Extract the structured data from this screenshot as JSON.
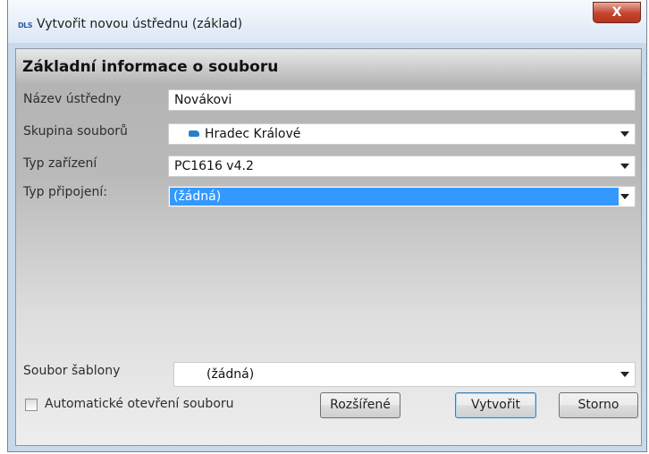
{
  "window": {
    "app_logo": "DLS",
    "title": "Vytvořit novou ústřednu (základ)",
    "close_symbol": "X"
  },
  "section": {
    "title": "Základní informace o souboru"
  },
  "form": {
    "panel_name": {
      "label": "Název ústředny",
      "value": "Novákovi"
    },
    "file_group": {
      "label": "Skupina souborů",
      "value": "Hradec Králové",
      "icon": "folder-icon"
    },
    "device_type": {
      "label": "Typ zařízení",
      "value": "PC1616 v4.2"
    },
    "connection_type": {
      "label": "Typ připojení:",
      "value": "(žádná)",
      "selected_color": "#3399ff"
    },
    "template_file": {
      "label": "Soubor šablony",
      "value": "(žádná)"
    }
  },
  "footer": {
    "auto_open": {
      "label": "Automatické otevření souboru",
      "checked": false
    },
    "advanced_label": "Rozšířené",
    "create_label": "Vytvořit",
    "cancel_label": "Storno"
  }
}
